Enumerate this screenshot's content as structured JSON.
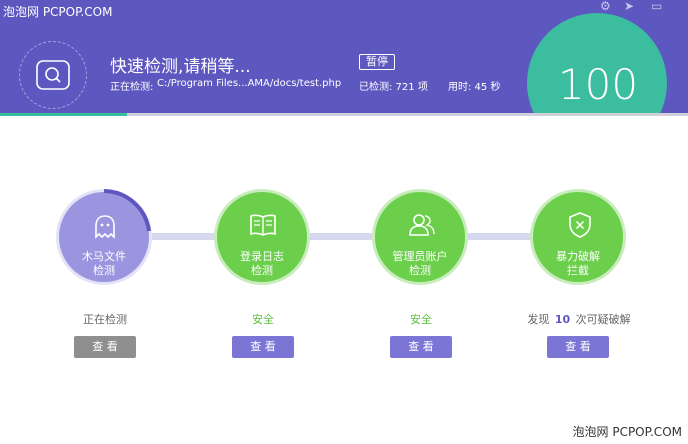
{
  "watermark": "泡泡网 PCPOP.COM",
  "header": {
    "title": "快速检测,请稍等...",
    "pause_label": "暂停",
    "scanning_label": "正在检测:",
    "scanning_path": "C:/Program Files...AMA/docs/test.php",
    "checked": "已检测: 721 项",
    "elapsed": "用时: 45 秒",
    "score": "100",
    "progress_fraction": 0.185
  },
  "steps": [
    {
      "label_line1": "木马文件",
      "label_line2": "检测",
      "status": "正在检测",
      "button": "查 看",
      "icon": "ghost-icon"
    },
    {
      "label_line1": "登录日志",
      "label_line2": "检测",
      "status": "安全",
      "button": "查 看",
      "icon": "book-icon"
    },
    {
      "label_line1": "管理员账户",
      "label_line2": "检测",
      "status": "安全",
      "button": "查 看",
      "icon": "users-icon"
    },
    {
      "label_line1": "暴力破解",
      "label_line2": "拦截",
      "status_prefix": "发现",
      "status_count": "10",
      "status_suffix": "次可疑破解",
      "button": "查 看",
      "icon": "shield-icon"
    }
  ],
  "colors": {
    "header": "#5d57c0",
    "accent_green": "#3dbda0",
    "step_active": "#9b95e0",
    "step_done": "#6bcf4b",
    "button_purple": "#7b76d6",
    "button_gray": "#8f8f8f"
  }
}
